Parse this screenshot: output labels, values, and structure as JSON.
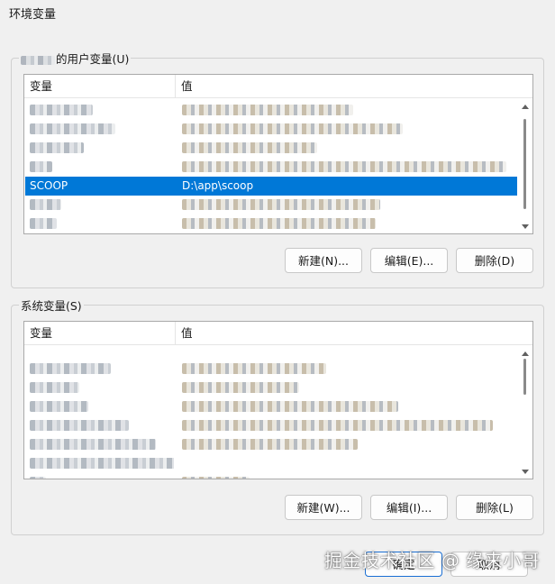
{
  "window": {
    "title": "环境变量"
  },
  "user_group": {
    "label": "的用户变量(U)",
    "header": {
      "variable": "变量",
      "value": "值"
    },
    "rows": [
      {
        "name": "",
        "value": "",
        "selected": false,
        "nw": 70,
        "vw": 190
      },
      {
        "name": "",
        "value": "",
        "selected": false,
        "nw": 95,
        "vw": 245
      },
      {
        "name": "",
        "value": "",
        "selected": false,
        "nw": 60,
        "vw": 150
      },
      {
        "name": "",
        "value": "",
        "selected": false,
        "nw": 25,
        "vw": 360
      },
      {
        "name": "SCOOP",
        "value": "D:\\app\\scoop",
        "selected": true
      },
      {
        "name": "",
        "value": "",
        "selected": false,
        "nw": 35,
        "vw": 220
      },
      {
        "name": "",
        "value": "",
        "selected": false,
        "nw": 30,
        "vw": 215
      },
      {
        "name": "",
        "value": "",
        "selected": false,
        "nw": 140,
        "vw": 290
      }
    ],
    "buttons": {
      "new": "新建(N)...",
      "edit": "编辑(E)...",
      "delete": "删除(D)"
    }
  },
  "system_group": {
    "label": "系统变量(S)",
    "header": {
      "variable": "变量",
      "value": "值"
    },
    "rows": [
      {
        "name": "",
        "value": "",
        "nw": 90,
        "vw": 160
      },
      {
        "name": "",
        "value": "",
        "nw": 55,
        "vw": 130
      },
      {
        "name": "",
        "value": "",
        "nw": 65,
        "vw": 240
      },
      {
        "name": "",
        "value": "",
        "nw": 110,
        "vw": 345
      },
      {
        "name": "",
        "value": "",
        "nw": 140,
        "vw": 195
      },
      {
        "name": "",
        "value": "",
        "nw": 165,
        "vw": 0
      },
      {
        "name": "",
        "value": "",
        "nw": 18,
        "vw": 75
      }
    ],
    "buttons": {
      "new": "新建(W)...",
      "edit": "编辑(I)...",
      "delete": "删除(L)"
    }
  },
  "dialog_buttons": {
    "ok": "确定",
    "cancel": "取消"
  },
  "watermark": "掘金技术社区 @ 缘来小哥"
}
